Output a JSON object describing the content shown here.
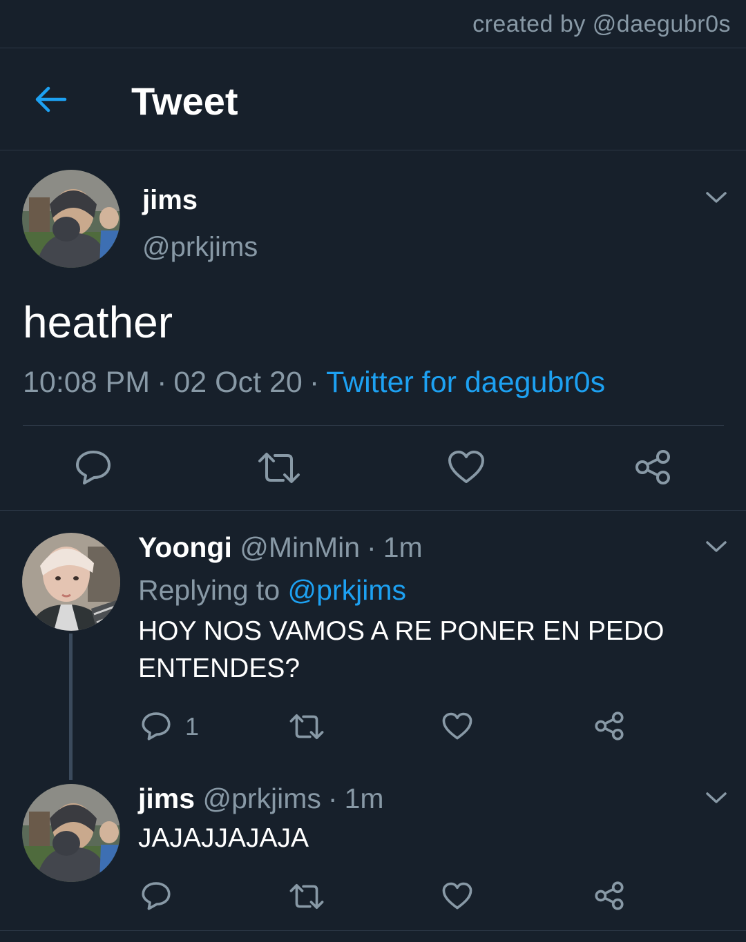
{
  "credit": "created by @daegubr0s",
  "header": {
    "title": "Tweet"
  },
  "main_tweet": {
    "name": "jims",
    "handle": "@prkjims",
    "text": "heather",
    "time": "10:08 PM",
    "date": "02 Oct 20",
    "source": "Twitter for daegubr0s"
  },
  "replies": [
    {
      "name": "Yoongi",
      "handle": "@MinMin",
      "age": "1m",
      "replying_label": "Replying to",
      "replying_to": "@prkjims",
      "text": "HOY NOS VAMOS A RE PONER EN PEDO ENTENDES?",
      "reply_count": "1"
    },
    {
      "name": "jims",
      "handle": "@prkjims",
      "age": "1m",
      "text": "JAJAJJAJAJA"
    }
  ],
  "separator": "·",
  "icons": [
    "back-arrow-icon",
    "chevron-down-icon",
    "reply-icon",
    "retweet-icon",
    "like-icon",
    "share-icon"
  ],
  "colors": {
    "background": "#17202b",
    "accent": "#1da1f2",
    "muted": "#8899a6",
    "divider": "#2c3846"
  }
}
